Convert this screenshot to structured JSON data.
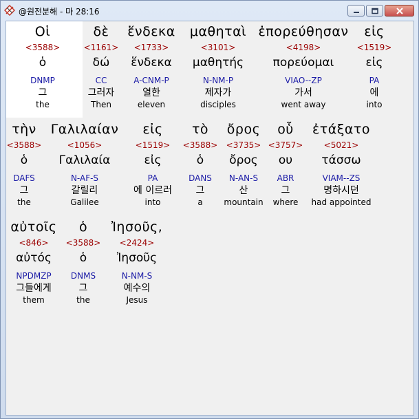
{
  "window": {
    "title": "@원전분해 - 마 28:16"
  },
  "rows": [
    {
      "words": [
        {
          "greek": "Οἱ",
          "strong": "<3588>",
          "lemma": "ὁ",
          "parse": "DNMP",
          "korean": "그",
          "english": "the"
        },
        {
          "greek": "δὲ",
          "strong": "<1161>",
          "lemma": "δώ",
          "parse": "CC",
          "korean": "그러자",
          "english": "Then"
        },
        {
          "greek": "ἕνδεκα",
          "strong": "<1733>",
          "lemma": "ἕνδεκα",
          "parse": "A-CNM-P",
          "korean": "열한",
          "english": "eleven"
        },
        {
          "greek": "μαθηταὶ",
          "strong": "<3101>",
          "lemma": "μαθητής",
          "parse": "N-NM-P",
          "korean": "제자가",
          "english": "disciples"
        },
        {
          "greek": "ἐπορεύθησαν",
          "strong": "<4198>",
          "lemma": "πορεύομαι",
          "parse": "VIAO--ZP",
          "korean": "가서",
          "english": "went away"
        },
        {
          "greek": "εἰς",
          "strong": "<1519>",
          "lemma": "εἰς",
          "parse": "PA",
          "korean": "에",
          "english": "into"
        }
      ]
    },
    {
      "words": [
        {
          "greek": "τὴν",
          "strong": "<3588>",
          "lemma": "ὁ",
          "parse": "DAFS",
          "korean": "그",
          "english": "the"
        },
        {
          "greek": "Γαλιλαίαν",
          "strong": "<1056>",
          "lemma": "Γαλιλαία",
          "parse": "N-AF-S",
          "korean": "갈릴리",
          "english": "Galilee"
        },
        {
          "greek": "εἰς",
          "strong": "<1519>",
          "lemma": "εἰς",
          "parse": "PA",
          "korean": "에 이르러",
          "english": "into"
        },
        {
          "greek": "τὸ",
          "strong": "<3588>",
          "lemma": "ὁ",
          "parse": "DANS",
          "korean": "그",
          "english": "a"
        },
        {
          "greek": "ὄρος",
          "strong": "<3735>",
          "lemma": "ὄρος",
          "parse": "N-AN-S",
          "korean": "산",
          "english": "mountain"
        },
        {
          "greek": "οὗ",
          "strong": "<3757>",
          "lemma": "ου",
          "parse": "ABR",
          "korean": "그",
          "english": "where"
        },
        {
          "greek": "ἐτάξατο",
          "strong": "<5021>",
          "lemma": "τάσσω",
          "parse": "VIAM--ZS",
          "korean": "명하시던",
          "english": "had appointed"
        }
      ]
    },
    {
      "words": [
        {
          "greek": "αὐτοῖς",
          "strong": "<846>",
          "lemma": "αὐτός",
          "parse": "NPDMZP",
          "korean": "그들에게",
          "english": "them"
        },
        {
          "greek": "ὁ",
          "strong": "<3588>",
          "lemma": "ὁ",
          "parse": "DNMS",
          "korean": "그",
          "english": "the"
        },
        {
          "greek": "Ἰησοῦς,",
          "strong": "<2424>",
          "lemma": "Ἰησοῦς",
          "parse": "N-NM-S",
          "korean": "예수의",
          "english": "Jesus"
        }
      ]
    }
  ],
  "colors": {
    "strong": "#9b0000",
    "parse": "#1a1aa6",
    "window_frame": "#cfdcee"
  }
}
